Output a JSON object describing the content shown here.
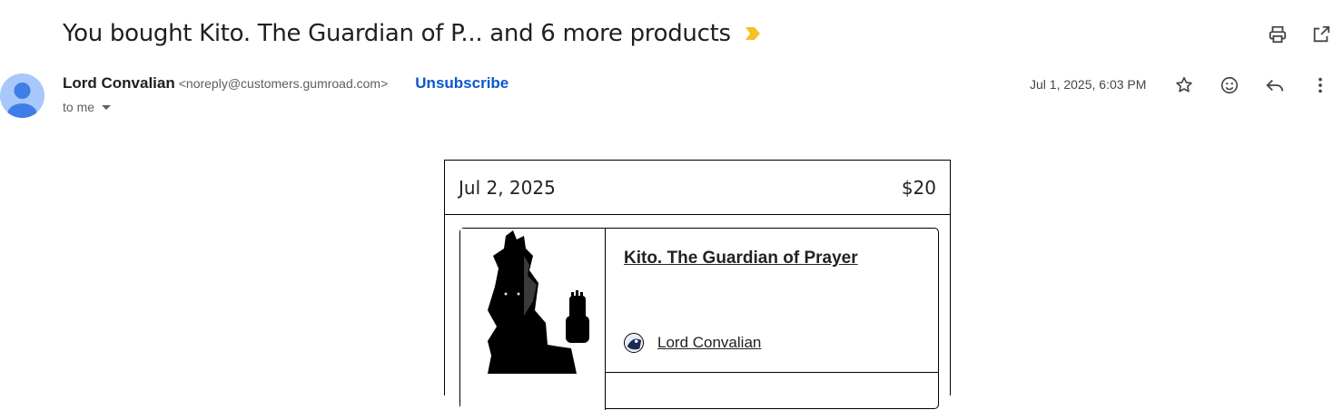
{
  "email": {
    "subject": "You bought Kito. The Guardian of P... and 6 more products",
    "label_color": "#f6c026",
    "sender": {
      "name": "Lord Convalian",
      "email": "<noreply@customers.gumroad.com>",
      "unsubscribe_label": "Unsubscribe",
      "to_label": "to me"
    },
    "date": "Jul 1, 2025, 6:03 PM",
    "icons": {
      "print": "print-icon",
      "open_new_window": "open-in-new-window-icon",
      "star": "star-icon",
      "emoji": "emoji-reaction-icon",
      "reply": "reply-icon",
      "more": "more-vert-icon"
    }
  },
  "receipt": {
    "date": "Jul 2, 2025",
    "total": "$20",
    "product": {
      "title": "Kito. The Guardian of Prayer",
      "creator": "Lord Convalian"
    }
  }
}
